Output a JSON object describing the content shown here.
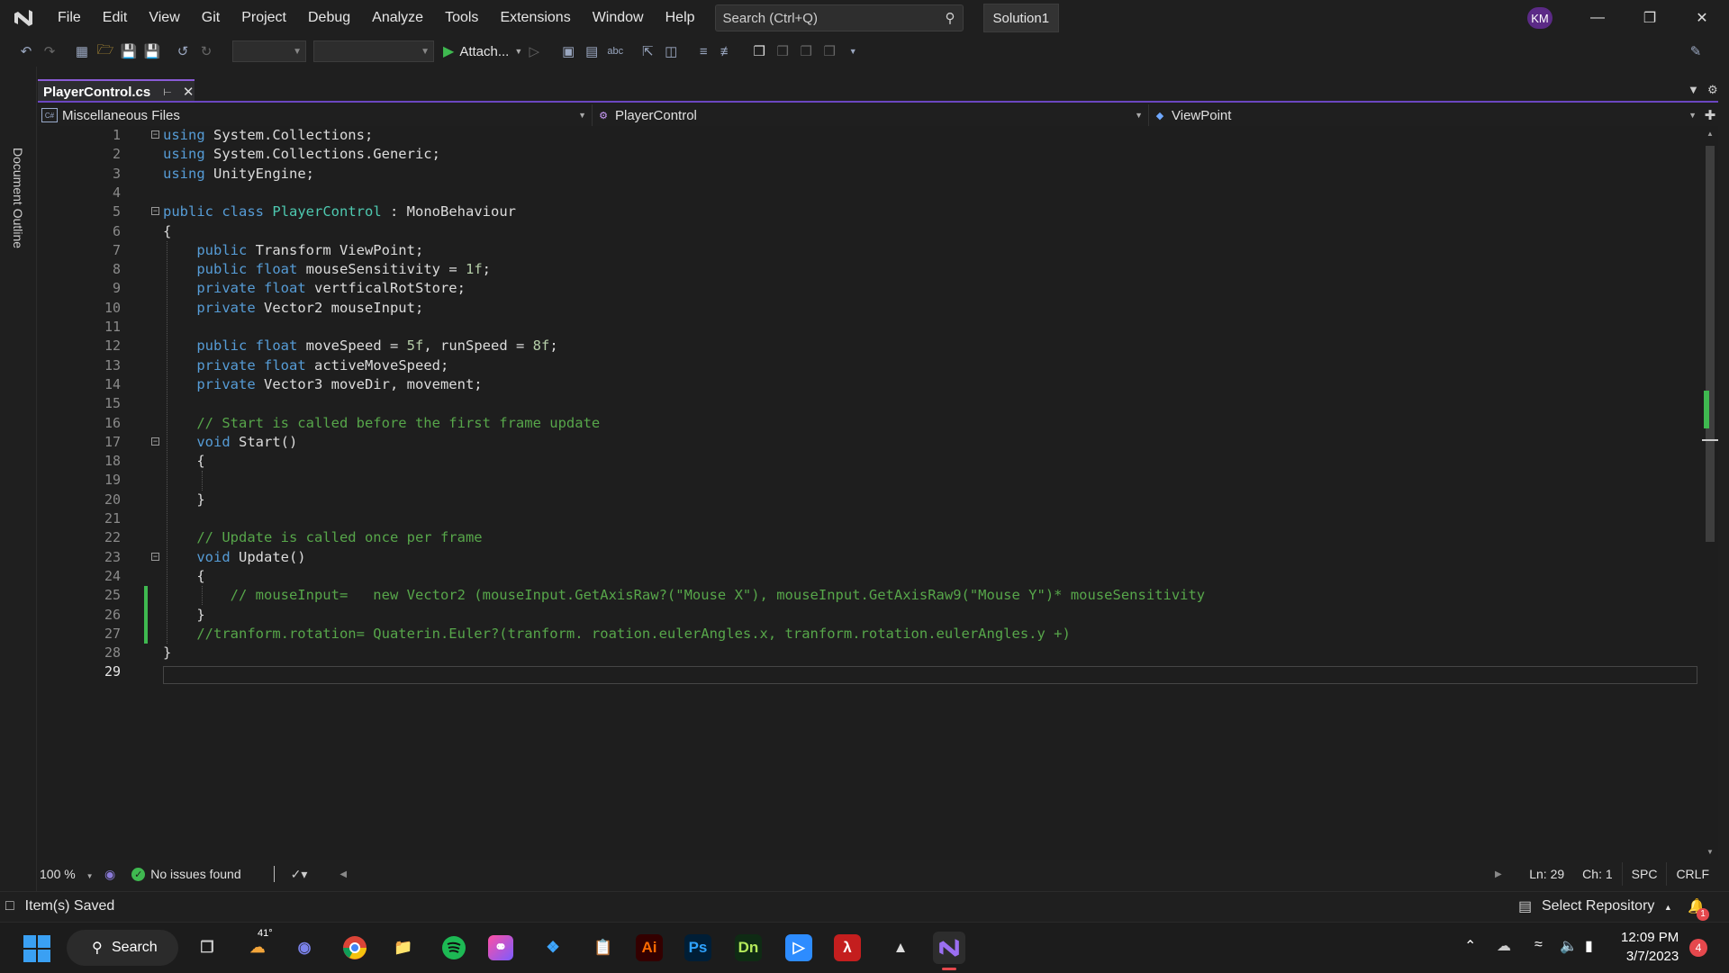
{
  "menu": [
    "File",
    "Edit",
    "View",
    "Git",
    "Project",
    "Debug",
    "Analyze",
    "Tools",
    "Extensions",
    "Window",
    "Help"
  ],
  "search": {
    "placeholder": "Search (Ctrl+Q)"
  },
  "solution_name": "Solution1",
  "user_initials": "KM",
  "toolbar": {
    "attach_label": "Attach..."
  },
  "document_outline": "Document Outline",
  "tab": {
    "filename": "PlayerControl.cs"
  },
  "nav": {
    "project": "Miscellaneous Files",
    "type": "PlayerControl",
    "member": "ViewPoint"
  },
  "code_lines": [
    [
      {
        "t": "using",
        "c": "kw"
      },
      {
        "t": " System.Collections;"
      }
    ],
    [
      {
        "t": "using",
        "c": "kw"
      },
      {
        "t": " System.Collections.Generic;"
      }
    ],
    [
      {
        "t": "using",
        "c": "kw"
      },
      {
        "t": " UnityEngine;"
      }
    ],
    [],
    [
      {
        "t": "public",
        "c": "kw"
      },
      {
        "t": " "
      },
      {
        "t": "class",
        "c": "kw"
      },
      {
        "t": " "
      },
      {
        "t": "PlayerControl",
        "c": "ty"
      },
      {
        "t": " : MonoBehaviour"
      }
    ],
    [
      {
        "t": "{"
      }
    ],
    [
      {
        "t": "    "
      },
      {
        "t": "public",
        "c": "kw"
      },
      {
        "t": " Transform ViewPoint;"
      }
    ],
    [
      {
        "t": "    "
      },
      {
        "t": "public",
        "c": "kw"
      },
      {
        "t": " "
      },
      {
        "t": "float",
        "c": "kw"
      },
      {
        "t": " mouseSensitivity = "
      },
      {
        "t": "1f",
        "c": "nm"
      },
      {
        "t": ";"
      }
    ],
    [
      {
        "t": "    "
      },
      {
        "t": "private",
        "c": "kw"
      },
      {
        "t": " "
      },
      {
        "t": "float",
        "c": "kw"
      },
      {
        "t": " vertficalRotStore;"
      }
    ],
    [
      {
        "t": "    "
      },
      {
        "t": "private",
        "c": "kw"
      },
      {
        "t": " Vector2 mouseInput;"
      }
    ],
    [],
    [
      {
        "t": "    "
      },
      {
        "t": "public",
        "c": "kw"
      },
      {
        "t": " "
      },
      {
        "t": "float",
        "c": "kw"
      },
      {
        "t": " moveSpeed = "
      },
      {
        "t": "5f",
        "c": "nm"
      },
      {
        "t": ", runSpeed = "
      },
      {
        "t": "8f",
        "c": "nm"
      },
      {
        "t": ";"
      }
    ],
    [
      {
        "t": "    "
      },
      {
        "t": "private",
        "c": "kw"
      },
      {
        "t": " "
      },
      {
        "t": "float",
        "c": "kw"
      },
      {
        "t": " activeMoveSpeed;"
      }
    ],
    [
      {
        "t": "    "
      },
      {
        "t": "private",
        "c": "kw"
      },
      {
        "t": " Vector3 moveDir, movement;"
      }
    ],
    [],
    [
      {
        "t": "    "
      },
      {
        "t": "// Start is called before the first frame update",
        "c": "cm"
      }
    ],
    [
      {
        "t": "    "
      },
      {
        "t": "void",
        "c": "kw"
      },
      {
        "t": " Start()"
      }
    ],
    [
      {
        "t": "    {"
      }
    ],
    [],
    [
      {
        "t": "    }"
      }
    ],
    [],
    [
      {
        "t": "    "
      },
      {
        "t": "// Update is called once per frame",
        "c": "cm"
      }
    ],
    [
      {
        "t": "    "
      },
      {
        "t": "void",
        "c": "kw"
      },
      {
        "t": " Update()"
      }
    ],
    [
      {
        "t": "    {"
      }
    ],
    [
      {
        "t": "        "
      },
      {
        "t": "// mouseInput=   new Vector2 (mouseInput.GetAxisRaw?(\"Mouse X\"), mouseInput.GetAxisRaw9(\"Mouse Y\")* mouseSensitivity",
        "c": "cm"
      }
    ],
    [
      {
        "t": "    }"
      }
    ],
    [
      {
        "t": "    "
      },
      {
        "t": "//tranform.rotation= Quaterin.Euler?(tranform. roation.eulerAngles.x, tranform.rotation.eulerAngles.y +)",
        "c": "cm"
      }
    ],
    [
      {
        "t": "}"
      }
    ],
    []
  ],
  "line_numbers": [
    "1",
    "2",
    "3",
    "4",
    "5",
    "6",
    "7",
    "8",
    "9",
    "10",
    "11",
    "12",
    "13",
    "14",
    "15",
    "16",
    "17",
    "18",
    "19",
    "20",
    "21",
    "22",
    "23",
    "24",
    "25",
    "26",
    "27",
    "28",
    "29"
  ],
  "editor_status": {
    "zoom": "100 %",
    "issues": "No issues found",
    "ln": "Ln: 29",
    "ch": "Ch: 1",
    "spc": "SPC",
    "crlf": "CRLF"
  },
  "status": {
    "message": "Item(s) Saved",
    "repo": "Select Repository",
    "notifications": "1"
  },
  "taskbar": {
    "search": "Search",
    "weather": "41°",
    "clock_time": "12:09 PM",
    "clock_date": "3/7/2023",
    "notif_count": "4",
    "apps": [
      {
        "name": "Ai",
        "color": "#ff6a00"
      },
      {
        "name": "Ps",
        "color": "#2fa3ff"
      },
      {
        "name": "Dn",
        "color": "#b4e85a"
      }
    ]
  },
  "colors": {
    "accent": "#6b46c1",
    "keyword": "#569cd6",
    "type": "#4ec9b0",
    "comment": "#57a64a",
    "number": "#b5cea8",
    "ok": "#3fb950"
  }
}
